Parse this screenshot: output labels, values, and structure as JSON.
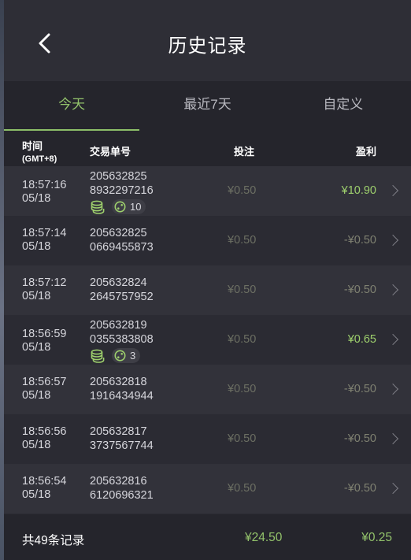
{
  "header": {
    "title": "历史记录"
  },
  "tabs": [
    {
      "label": "今天",
      "active": true
    },
    {
      "label": "最近7天",
      "active": false
    },
    {
      "label": "自定义",
      "active": false
    }
  ],
  "columns": {
    "time": "时间",
    "time_sub": "(GMT+8)",
    "order": "交易单号",
    "bet": "投注",
    "profit": "盈利"
  },
  "rows": [
    {
      "time": "18:57:16",
      "date": "05/18",
      "order_a": "205632825",
      "order_b": "8932297216",
      "bet": "¥0.50",
      "profit": "¥10.90",
      "profit_positive": true,
      "multiplier": "10"
    },
    {
      "time": "18:57:14",
      "date": "05/18",
      "order_a": "205632825",
      "order_b": "0669455873",
      "bet": "¥0.50",
      "profit": "-¥0.50",
      "profit_positive": false,
      "multiplier": null
    },
    {
      "time": "18:57:12",
      "date": "05/18",
      "order_a": "205632824",
      "order_b": "2645757952",
      "bet": "¥0.50",
      "profit": "-¥0.50",
      "profit_positive": false,
      "multiplier": null
    },
    {
      "time": "18:56:59",
      "date": "05/18",
      "order_a": "205632819",
      "order_b": "0355383808",
      "bet": "¥0.50",
      "profit": "¥0.65",
      "profit_positive": true,
      "multiplier": "3"
    },
    {
      "time": "18:56:57",
      "date": "05/18",
      "order_a": "205632818",
      "order_b": "1916434944",
      "bet": "¥0.50",
      "profit": "-¥0.50",
      "profit_positive": false,
      "multiplier": null
    },
    {
      "time": "18:56:56",
      "date": "05/18",
      "order_a": "205632817",
      "order_b": "3737567744",
      "bet": "¥0.50",
      "profit": "-¥0.50",
      "profit_positive": false,
      "multiplier": null
    },
    {
      "time": "18:56:54",
      "date": "05/18",
      "order_a": "205632816",
      "order_b": "6120696321",
      "bet": "¥0.50",
      "profit": "-¥0.50",
      "profit_positive": false,
      "multiplier": null
    }
  ],
  "footer": {
    "count_label": "共49条记录",
    "total_bet": "¥24.50",
    "total_profit": "¥0.25"
  },
  "colors": {
    "accent": "#93c36b",
    "profit_positive": "#9ed06d",
    "profit_negative": "#7f8171",
    "background": "#2b2b33"
  },
  "icons": {
    "back": "chevron-left-icon",
    "row_arrow": "chevron-right-icon",
    "coins": "coin-stack-icon",
    "multiplier": "dice-icon"
  }
}
